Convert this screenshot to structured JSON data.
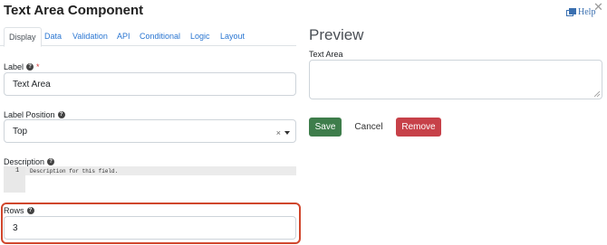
{
  "dialog": {
    "title": "Text Area Component",
    "help_label": "Help",
    "close_glyph": "✕"
  },
  "tabs": [
    {
      "label": "Display",
      "active": true
    },
    {
      "label": "Data"
    },
    {
      "label": "Validation"
    },
    {
      "label": "API"
    },
    {
      "label": "Conditional"
    },
    {
      "label": "Logic"
    },
    {
      "label": "Layout"
    }
  ],
  "form": {
    "label_field": {
      "label": "Label",
      "required_mark": "*",
      "value": "Text Area"
    },
    "label_position": {
      "label": "Label Position",
      "value": "Top",
      "clear_glyph": "×"
    },
    "description": {
      "label": "Description",
      "line_number": "1",
      "placeholder": "Description for this field."
    },
    "rows": {
      "label": "Rows",
      "value": "3"
    }
  },
  "preview": {
    "title": "Preview",
    "field_label": "Text Area",
    "buttons": {
      "save": "Save",
      "cancel": "Cancel",
      "remove": "Remove"
    }
  },
  "colors": {
    "accent": "#2a76d2",
    "save": "#3e7d4b",
    "remove": "#c74149",
    "highlight": "#d0462c"
  },
  "icons": [
    "help-icon",
    "question-icon",
    "close-icon",
    "clear-icon",
    "caret-down-icon",
    "resize-handle-icon"
  ]
}
